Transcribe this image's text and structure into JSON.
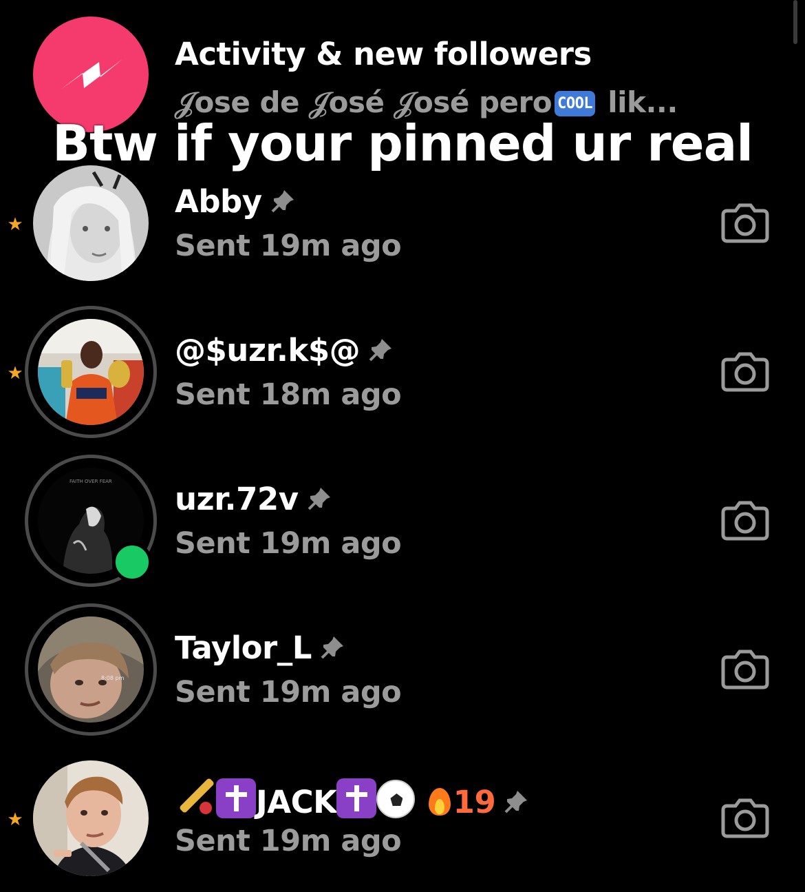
{
  "caption": "Btw if your pinned ur real",
  "activity": {
    "title": "Activity & new followers",
    "subtitle_before": "𝒥ose de 𝒥osé 𝒥osé pero",
    "subtitle_badge": "COOL",
    "subtitle_after": " lik..."
  },
  "colors": {
    "background": "#000000",
    "activity_icon": "#f53b6e",
    "star": "#f5a623",
    "online": "#18c964",
    "secondary_text": "#9b9b9b",
    "streak": "#ff6a3d"
  },
  "chats": [
    {
      "name": "Abby",
      "status": "Sent 19m ago",
      "starred": true,
      "ring": false,
      "online": false
    },
    {
      "name": "@$uzr.k$@",
      "status": "Sent 18m ago",
      "starred": true,
      "ring": true,
      "online": false
    },
    {
      "name": "uzr.72v",
      "status": "Sent 19m ago",
      "starred": false,
      "ring": true,
      "online": true
    },
    {
      "name": "Taylor_L",
      "status": "Sent 19m ago",
      "starred": false,
      "ring": true,
      "online": false
    },
    {
      "name": "JACK",
      "streak": "19",
      "status": "Sent 19m ago",
      "starred": true,
      "ring": false,
      "online": false
    }
  ],
  "avatars": {
    "faith_text": "FAITH OVER FEAR",
    "time_text": "8:08 pm"
  }
}
